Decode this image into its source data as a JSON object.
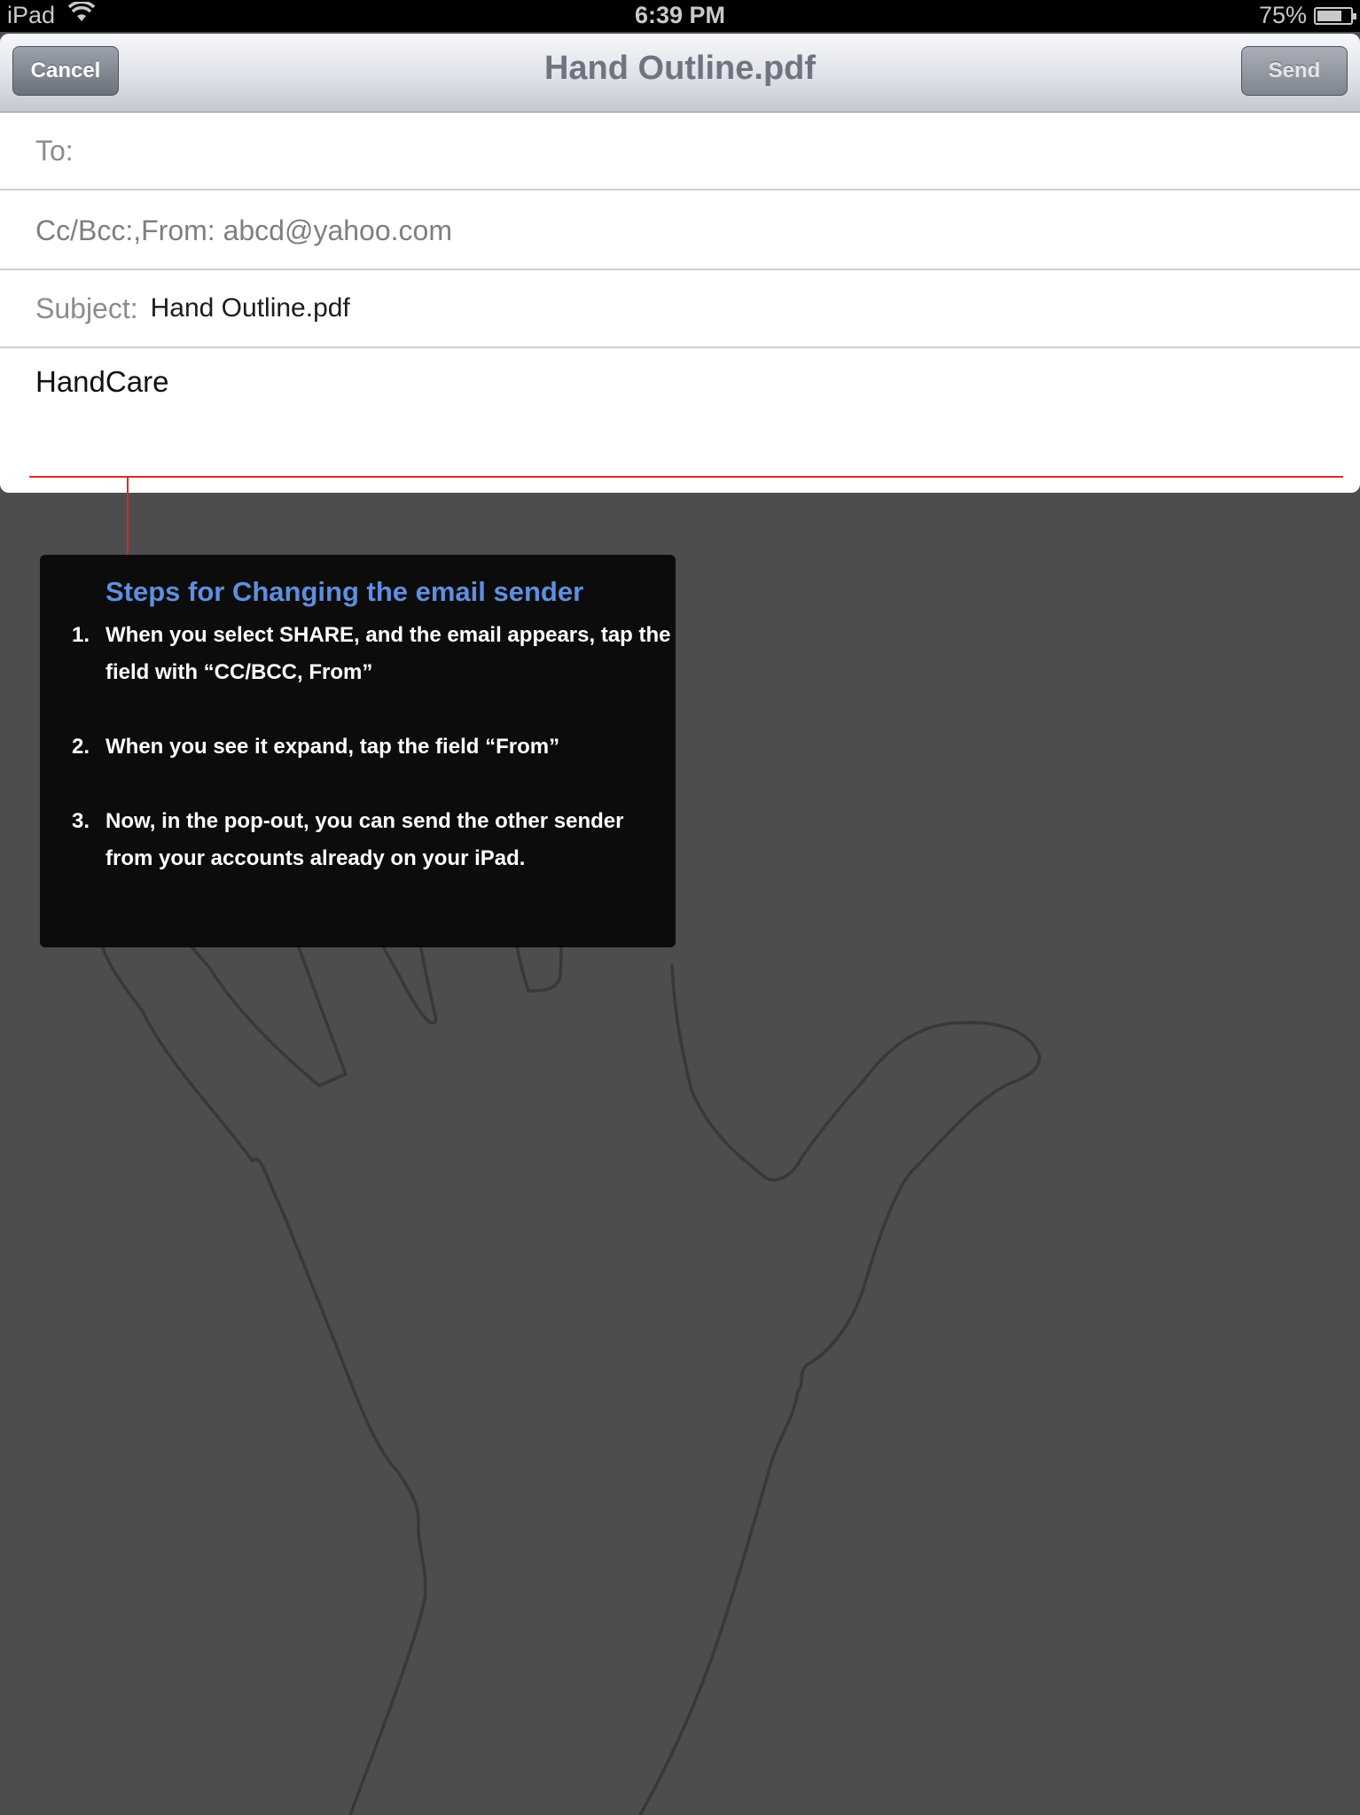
{
  "status_bar": {
    "device": "iPad",
    "time": "6:39 PM",
    "battery": "75%",
    "battery_level": 0.75
  },
  "compose": {
    "title": "Hand Outline.pdf",
    "cancel_label": "Cancel",
    "send_label": "Send",
    "to_label": "To:",
    "cc_from_label": "Cc/Bcc:,From: abcd@yahoo.com",
    "subject_label": "Subject:",
    "subject_value": "Hand Outline.pdf",
    "body": "HandCare"
  },
  "instructions": {
    "title": "Steps for Changing the email sender",
    "steps": [
      {
        "num": "1.",
        "text": "When you select SHARE, and the email appears, tap the field with “CC/BCC, From”"
      },
      {
        "num": "2.",
        "text": "When you see it expand, tap the field “From”"
      },
      {
        "num": "3.",
        "text": "Now, in the pop-out, you can send the other sender from your accounts already on your iPad."
      }
    ]
  },
  "colors": {
    "accent": "#5e8fe0",
    "annotation_line": "#d62a2a",
    "backdrop": "#4d4d4d"
  }
}
